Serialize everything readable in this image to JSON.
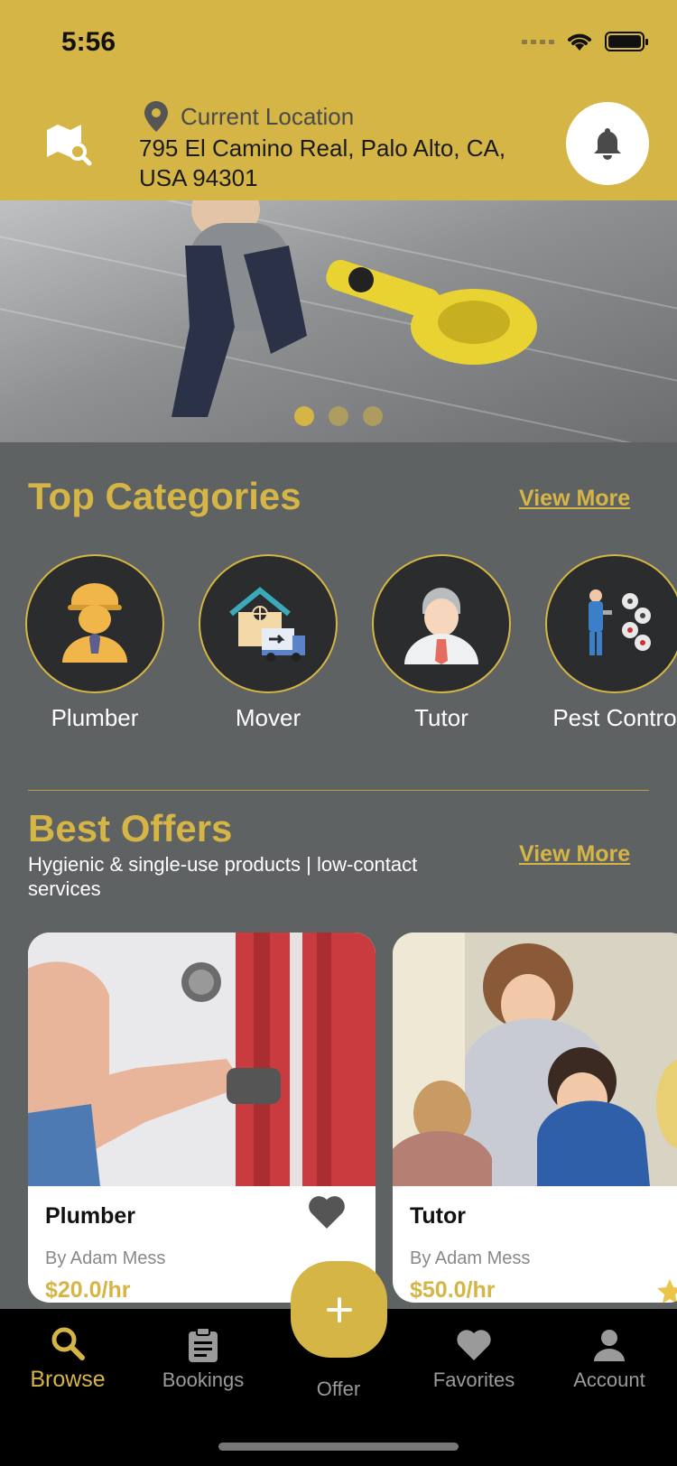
{
  "status_bar": {
    "time": "5:56"
  },
  "header": {
    "location_label": "Current Location",
    "address": "795 El Camino Real, Palo Alto, CA, USA 94301",
    "map_icon": "map-search-icon",
    "bell_icon": "bell-icon"
  },
  "hero": {
    "slides": 3,
    "active_slide": 1
  },
  "top_categories": {
    "title": "Top Categories",
    "view_more": "View More",
    "items": [
      {
        "label": "Plumber",
        "icon": "plumber-icon"
      },
      {
        "label": "Mover",
        "icon": "mover-icon"
      },
      {
        "label": "Tutor",
        "icon": "tutor-icon"
      },
      {
        "label": "Pest Contro",
        "icon": "pest-control-icon"
      }
    ]
  },
  "best_offers": {
    "title": "Best Offers",
    "subtitle": "Hygienic & single-use products | low-contact services",
    "view_more": "View More",
    "cards": [
      {
        "title": "Plumber",
        "by": "By Adam Mess",
        "price": "$20.0/hr"
      },
      {
        "title": "Tutor",
        "by": "By Adam Mess",
        "price": "$50.0/hr"
      }
    ]
  },
  "bottom_nav": {
    "items": [
      {
        "label": "Browse",
        "icon": "search-icon",
        "active": true
      },
      {
        "label": "Bookings",
        "icon": "clipboard-icon",
        "active": false
      },
      {
        "label": "Offer",
        "icon": "plus-icon",
        "active": false
      },
      {
        "label": "Favorites",
        "icon": "heart-icon",
        "active": false
      },
      {
        "label": "Account",
        "icon": "person-icon",
        "active": false
      }
    ]
  },
  "colors": {
    "accent": "#d4b545",
    "background": "#5f6263",
    "nav": "#000000"
  }
}
